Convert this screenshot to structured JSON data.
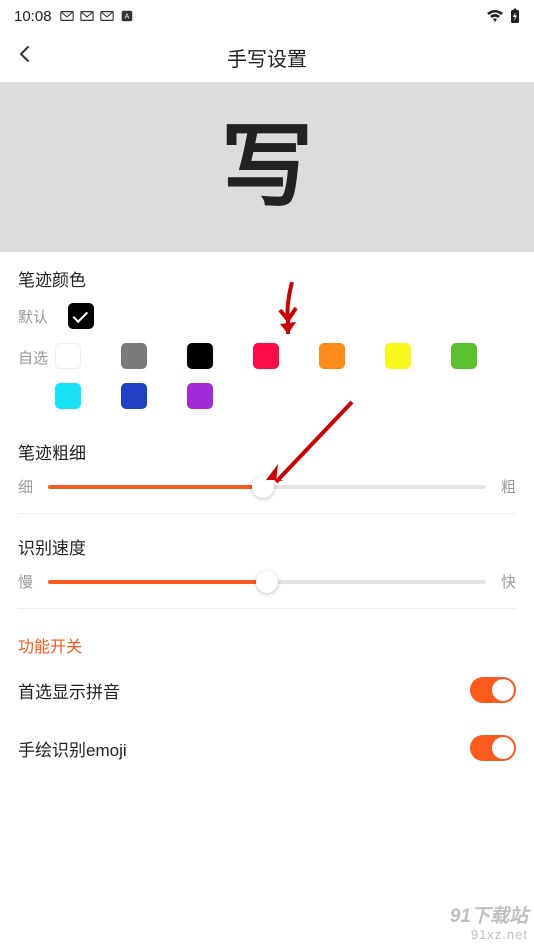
{
  "status": {
    "time": "10:08"
  },
  "header": {
    "title": "手写设置"
  },
  "preview": {
    "char": "写"
  },
  "stroke_color": {
    "title": "笔迹颜色",
    "default_label": "默认",
    "custom_label": "自选",
    "colors": [
      {
        "hex": "#ffffff",
        "border": "#eee"
      },
      {
        "hex": "#7a7a7a"
      },
      {
        "hex": "#000000"
      },
      {
        "hex": "#ff0b49"
      },
      {
        "hex": "#ff8c1a"
      },
      {
        "hex": "#f6f71c"
      },
      {
        "hex": "#5bc12e"
      },
      {
        "hex": "#18e3f5"
      },
      {
        "hex": "#1f3fc4"
      },
      {
        "hex": "#a02bd6"
      }
    ]
  },
  "stroke_width": {
    "title": "笔迹粗细",
    "min_label": "细",
    "max_label": "粗",
    "percent": 49
  },
  "recognition_speed": {
    "title": "识别速度",
    "min_label": "慢",
    "max_label": "快",
    "percent": 50
  },
  "features": {
    "title": "功能开关",
    "items": [
      {
        "label": "首选显示拼音",
        "on": true
      },
      {
        "label": "手绘识别emoji",
        "on": true
      }
    ]
  },
  "watermark": {
    "line1": "91下载站",
    "line2": "91xz.net"
  }
}
